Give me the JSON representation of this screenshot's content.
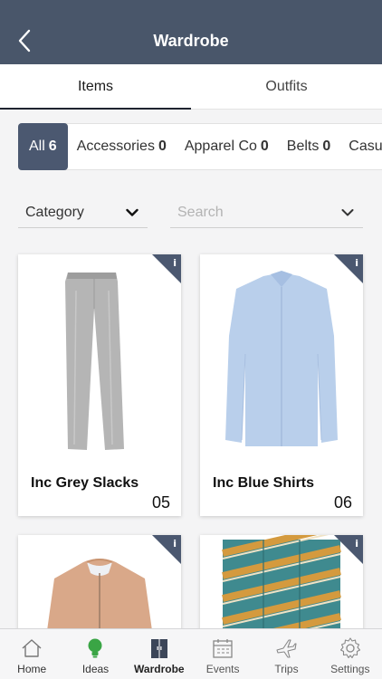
{
  "header": {
    "title": "Wardrobe"
  },
  "tabs": [
    {
      "label": "Items",
      "active": true
    },
    {
      "label": "Outfits",
      "active": false
    }
  ],
  "categories": [
    {
      "label": "All",
      "count": "6",
      "active": true
    },
    {
      "label": "Accessories",
      "count": "0"
    },
    {
      "label": "Apparel Co",
      "count": "0"
    },
    {
      "label": "Belts",
      "count": "0"
    },
    {
      "label": "Casu",
      "count": ""
    }
  ],
  "filters": {
    "category_label": "Category",
    "search_placeholder": "Search"
  },
  "items": [
    {
      "name": "Inc Grey Slacks",
      "number": "05",
      "info": "i"
    },
    {
      "name": "Inc Blue Shirts",
      "number": "06",
      "info": "i"
    },
    {
      "name": "",
      "number": "",
      "info": "i"
    },
    {
      "name": "",
      "number": "",
      "info": "i"
    }
  ],
  "tabbar": [
    {
      "label": "Home",
      "icon": "home-icon"
    },
    {
      "label": "Ideas",
      "icon": "lightbulb-icon"
    },
    {
      "label": "Wardrobe",
      "icon": "wardrobe-icon",
      "active": true
    },
    {
      "label": "Events",
      "icon": "calendar-icon"
    },
    {
      "label": "Trips",
      "icon": "airplane-icon"
    },
    {
      "label": "Settings",
      "icon": "gear-icon"
    }
  ],
  "colors": {
    "header_bg": "#49566a",
    "accent": "#4b5870",
    "ideas_green": "#3aa545"
  }
}
